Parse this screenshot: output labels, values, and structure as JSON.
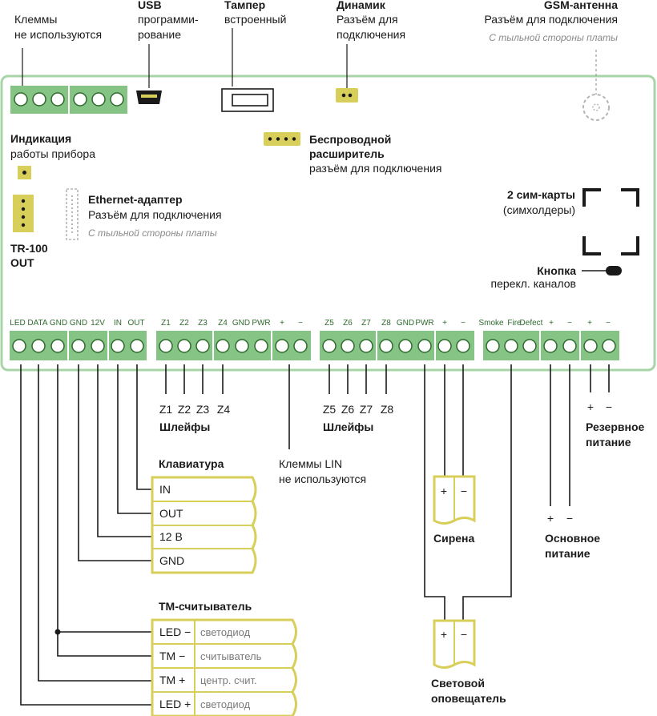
{
  "colors": {
    "board_border": "#a8d5a8",
    "terminal_green": "#86c486",
    "connector_yellow": "#d8cf5a",
    "wire": "#1a1a1a",
    "card_border": "#d8cf5a",
    "dashed": "#b5b5b5"
  },
  "top_labels": {
    "unused_terminals": {
      "line1": "Клеммы",
      "line2": "не используются"
    },
    "usb": {
      "title": "USB",
      "line1": "программи-",
      "line2": "рование"
    },
    "tamper": {
      "title": "Тампер",
      "line1": "встроенный"
    },
    "speaker": {
      "title": "Динамик",
      "line1": "Разъём для",
      "line2": "подключения"
    },
    "gsm": {
      "title": "GSM-антенна",
      "line1": "Разъём для подключения",
      "note": "С тыльной стороны платы"
    }
  },
  "board": {
    "indication": {
      "title": "Индикация",
      "line1": "работы прибора"
    },
    "wireless": {
      "title1": "Беспроводной",
      "title2": "расширитель",
      "line1": "разъём для подключения"
    },
    "ethernet": {
      "title": "Ethernet-адаптер",
      "line1": "Разъём для подключения",
      "note": "С тыльной стороны платы"
    },
    "tr100": {
      "line1": "TR-100",
      "line2": "OUT"
    },
    "sim": {
      "title": "2 сим-карты",
      "line1": "(симхолдеры)"
    },
    "button": {
      "title": "Кнопка",
      "line1": "перекл. каналов"
    },
    "terminal_labels": [
      "LED",
      "DATA",
      "GND",
      "GND",
      "12V",
      "IN",
      "OUT",
      "Z1",
      "Z2",
      "Z3",
      "Z4",
      "GND",
      "PWR",
      "+",
      "−",
      "Z5",
      "Z6",
      "Z7",
      "Z8",
      "GND",
      "PWR",
      "+",
      "−",
      "Smoke",
      "Fire",
      "Defect",
      "+",
      "−",
      "+",
      "−"
    ]
  },
  "loops_left": {
    "labels": [
      "Z1",
      "Z2",
      "Z3",
      "Z4"
    ],
    "title": "Шлейфы"
  },
  "loops_right": {
    "labels": [
      "Z5",
      "Z6",
      "Z7",
      "Z8"
    ],
    "title": "Шлейфы"
  },
  "lin": {
    "line1": "Клеммы LIN",
    "line2": "не используются"
  },
  "keypad": {
    "title": "Клавиатура",
    "rows": [
      "IN",
      "OUT",
      "12 В",
      "GND"
    ]
  },
  "reader": {
    "title": "ТМ-считыватель",
    "rows": [
      {
        "pin": "LED −",
        "desc": "светодиод"
      },
      {
        "pin": "TM −",
        "desc": "считыватель"
      },
      {
        "pin": "TM +",
        "desc": "центр. счит."
      },
      {
        "pin": "LED +",
        "desc": "светодиод"
      }
    ]
  },
  "siren": {
    "title": "Сирена",
    "plus": "+",
    "minus": "−"
  },
  "strobe": {
    "title1": "Световой",
    "title2": "оповещатель",
    "plus": "+",
    "minus": "−"
  },
  "main_power": {
    "title1": "Основное",
    "title2": "питание",
    "plus": "+",
    "minus": "−"
  },
  "backup_power": {
    "title1": "Резервное",
    "title2": "питание",
    "plus": "+",
    "minus": "−"
  }
}
